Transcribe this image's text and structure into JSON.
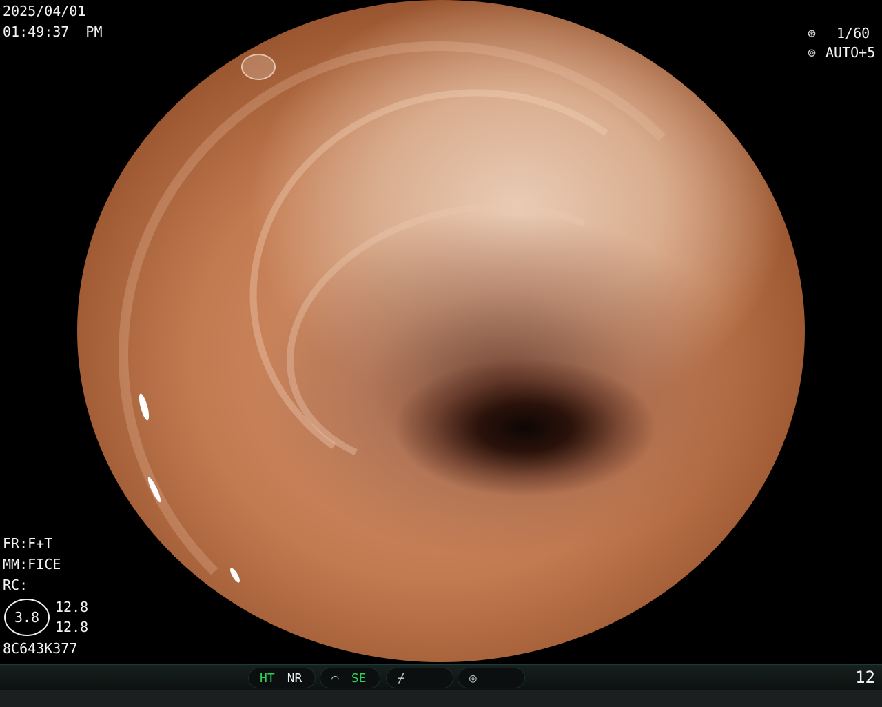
{
  "datetime": {
    "date": "2025/04/01",
    "time": "01:49:37  PM"
  },
  "camera": {
    "shutter_icon": "shutter-icon",
    "shutter": "1/60",
    "iris_icon": "iris-icon",
    "exposure": "AUTO+5"
  },
  "settings": {
    "fr": "FR:F+T",
    "mm": "MM:FICE",
    "rc": "RC:",
    "gauge_value": "3.8",
    "gauge_top": "12.8",
    "gauge_bottom": "12.8",
    "serial": "8C643K377"
  },
  "status_bar": {
    "ht": "HT",
    "nr": "NR",
    "se": "SE",
    "counter": "12",
    "colors": {
      "active": "#2fd05a",
      "label": "#f0f0f0"
    }
  }
}
